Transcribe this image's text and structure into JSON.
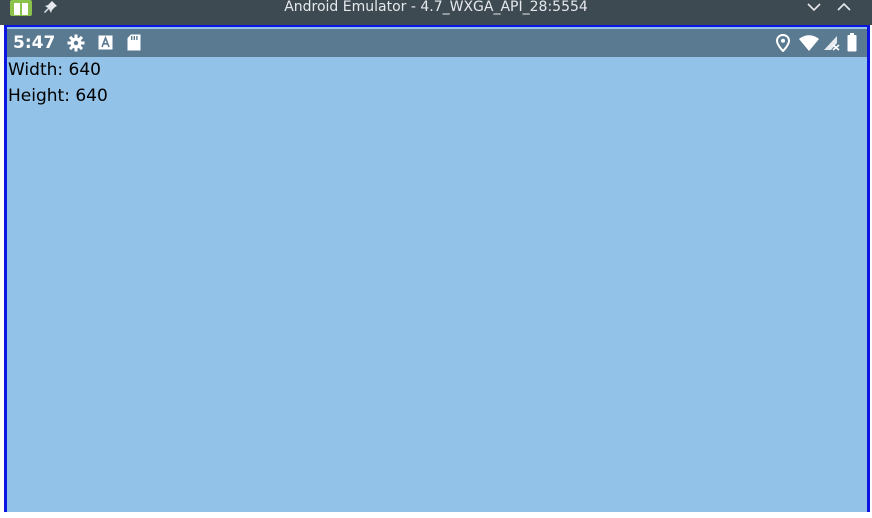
{
  "window": {
    "title": "Android Emulator - 4.7_WXGA_API_28:5554"
  },
  "statusbar": {
    "time": "5:47",
    "left_icons": [
      "settings-gear-icon",
      "accessibility-a-icon",
      "sd-card-icon"
    ],
    "right_icons": [
      "location-pin-icon",
      "wifi-icon",
      "no-signal-icon",
      "battery-icon"
    ]
  },
  "content": {
    "width_line": "Width: 640",
    "height_line": "Height: 640"
  },
  "colors": {
    "titlebar": "#3d4a52",
    "frame_border": "#0b17e0",
    "statusbar": "#5a7a91",
    "content_bg": "#92c2e7"
  }
}
